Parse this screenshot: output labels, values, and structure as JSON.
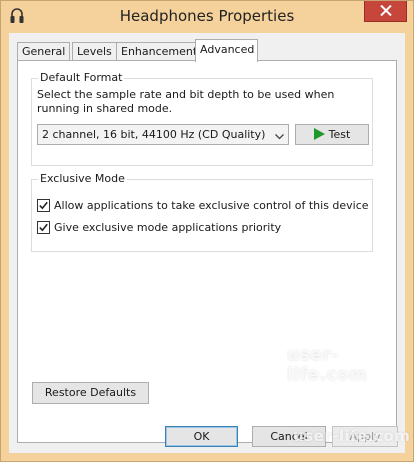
{
  "window": {
    "title": "Headphones Properties",
    "frame_color": "#f5d29b",
    "close_color": "#c7463b"
  },
  "tabs": [
    {
      "label": "General",
      "active": false
    },
    {
      "label": "Levels",
      "active": false
    },
    {
      "label": "Enhancements",
      "active": false
    },
    {
      "label": "Advanced",
      "active": true
    }
  ],
  "default_format": {
    "group_label": "Default Format",
    "description": "Select the sample rate and bit depth to be used when running in shared mode.",
    "selected_format": "2 channel, 16 bit, 44100 Hz (CD Quality)",
    "test_label": "Test"
  },
  "exclusive_mode": {
    "group_label": "Exclusive Mode",
    "options": [
      {
        "label": "Allow applications to take exclusive control of this device",
        "checked": true
      },
      {
        "label": "Give exclusive mode applications priority",
        "checked": true
      }
    ]
  },
  "buttons": {
    "restore": "Restore Defaults",
    "ok": "OK",
    "cancel": "Cancel",
    "apply": "Apply"
  },
  "watermark": "user-life.com",
  "icons": {
    "app": "headphones-icon",
    "close": "close-icon",
    "play": "play-icon",
    "check": "checkmark-icon",
    "dropdown": "chevron-down-icon"
  }
}
